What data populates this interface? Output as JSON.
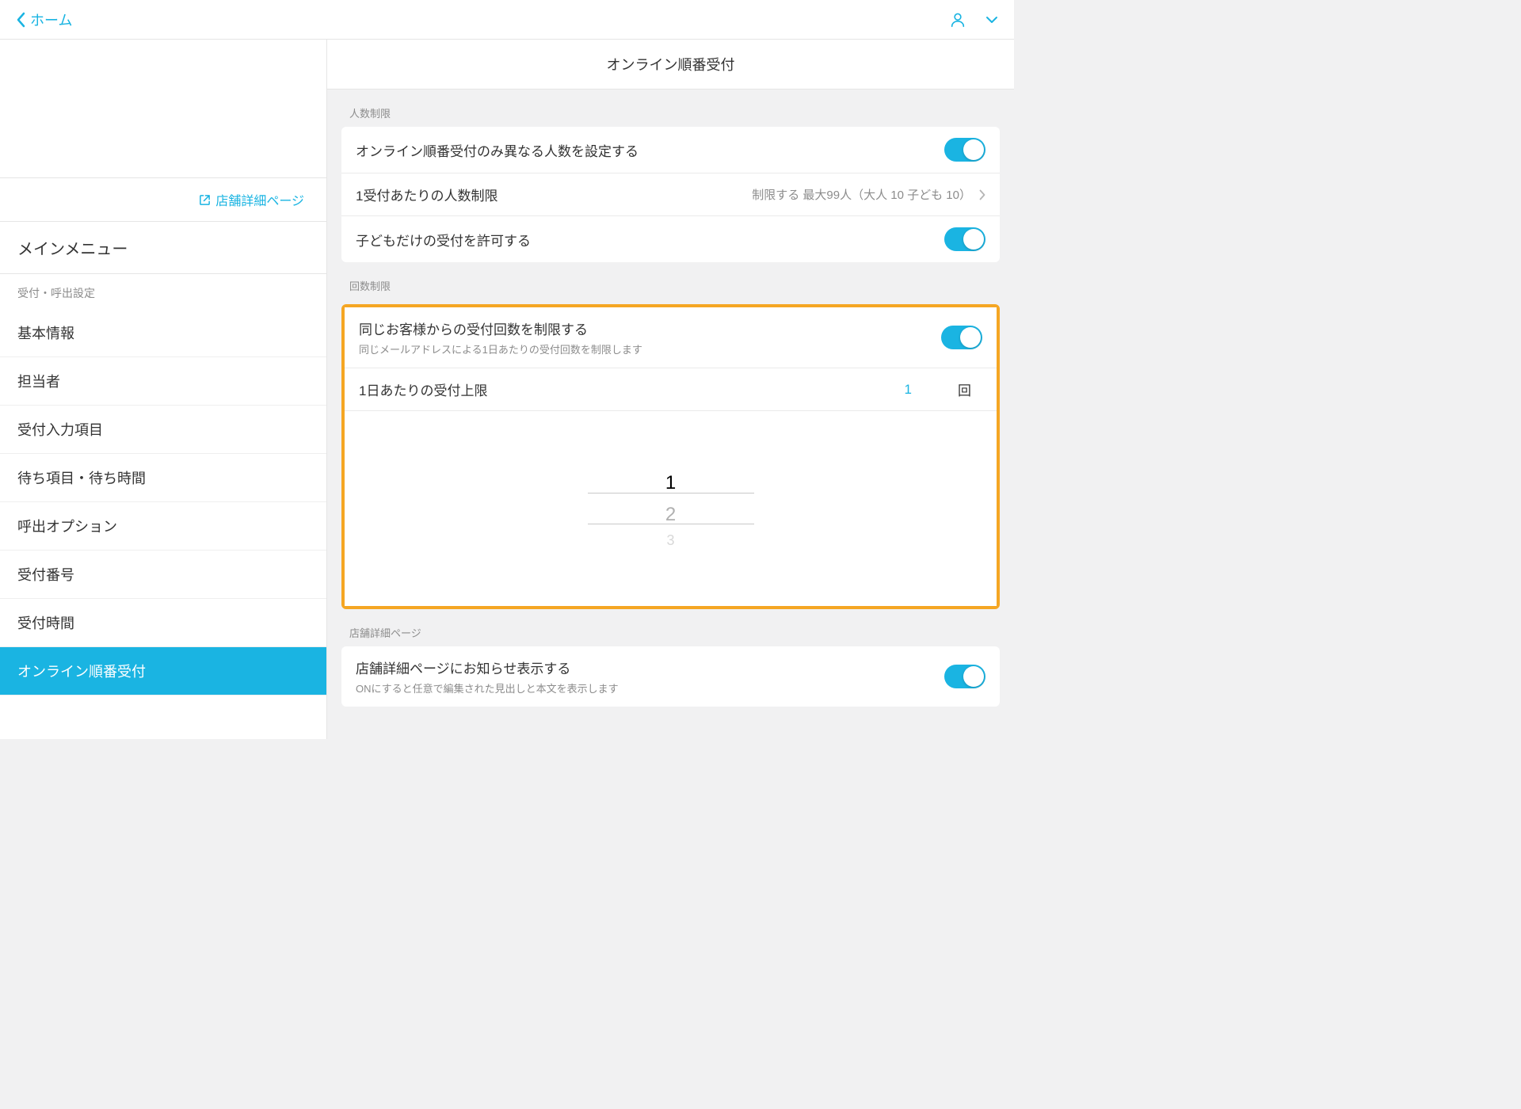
{
  "header": {
    "back_label": "ホーム"
  },
  "sidebar": {
    "store_link": "店舗詳細ページ",
    "main_menu": "メインメニュー",
    "section_label": "受付・呼出設定",
    "items": [
      {
        "label": "基本情報"
      },
      {
        "label": "担当者"
      },
      {
        "label": "受付入力項目"
      },
      {
        "label": "待ち項目・待ち時間"
      },
      {
        "label": "呼出オプション"
      },
      {
        "label": "受付番号"
      },
      {
        "label": "受付時間"
      },
      {
        "label": "オンライン順番受付",
        "active": true
      }
    ]
  },
  "main": {
    "title": "オンライン順番受付",
    "section1": {
      "label": "人数制限",
      "row1": "オンライン順番受付のみ異なる人数を設定する",
      "row2": "1受付あたりの人数制限",
      "row2_val": "制限する 最大99人（大人 10 子ども 10）",
      "row3": "子どもだけの受付を許可する"
    },
    "section2": {
      "label": "回数制限",
      "row1": "同じお客様からの受付回数を制限する",
      "row1_sub": "同じメールアドレスによる1日あたりの受付回数を制限します",
      "row2": "1日あたりの受付上限",
      "row2_val": "1",
      "row2_unit": "回",
      "picker": {
        "v1": "1",
        "v2": "2",
        "v3": "3"
      }
    },
    "section3": {
      "label": "店舗詳細ページ",
      "row1": "店舗詳細ページにお知らせ表示する",
      "row1_sub": "ONにすると任意で編集された見出しと本文を表示します"
    }
  }
}
